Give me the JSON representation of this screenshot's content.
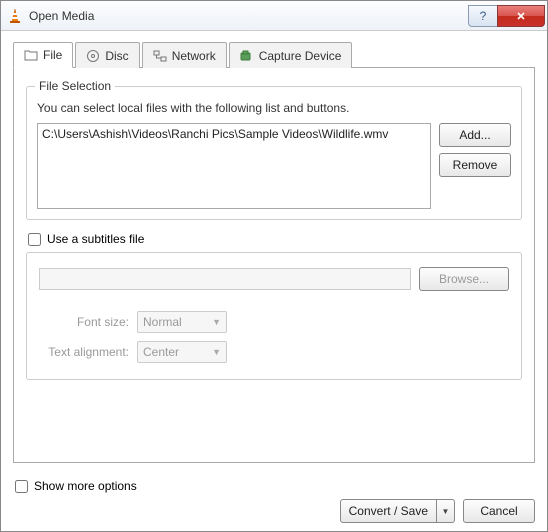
{
  "window": {
    "title": "Open Media"
  },
  "tabs": {
    "file": "File",
    "disc": "Disc",
    "network": "Network",
    "capture": "Capture Device"
  },
  "file_selection": {
    "legend": "File Selection",
    "helper": "You can select local files with the following list and buttons.",
    "items": [
      "C:\\Users\\Ashish\\Videos\\Ranchi Pics\\Sample Videos\\Wildlife.wmv"
    ],
    "add": "Add...",
    "remove": "Remove"
  },
  "subtitles": {
    "checkbox": "Use a subtitles file",
    "browse": "Browse...",
    "font_label": "Font size:",
    "font_value": "Normal",
    "align_label": "Text alignment:",
    "align_value": "Center"
  },
  "footer": {
    "more": "Show more options",
    "convert": "Convert / Save",
    "cancel": "Cancel"
  }
}
